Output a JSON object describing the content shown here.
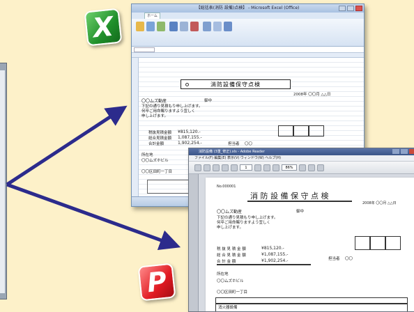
{
  "excel": {
    "window_title": "【総括表(消防 設備)点検】 - Microsoft Excel (Office)",
    "tab_home": "ホーム",
    "doc_title": "消防設備保守点検",
    "date_line": "2008年 〇〇月 △△日",
    "recipient": "〇〇ムズ動産",
    "honorific": "御中",
    "greeting_1": "下記の通り見積もり申し上げます。",
    "greeting_2": "何卒ご用命賜りますよう宜しく",
    "greeting_3": "申し上げます。",
    "amount_1_label": "税抜見積金額",
    "amount_1_value": "¥815,120.-",
    "amount_2_label": "総合見積金額",
    "amount_2_value": "1,087,155.-",
    "amount_3_label": "合計金額",
    "amount_3_value": "1,902,254.-",
    "person_label": "担当者",
    "person_value": "〇〇",
    "address_label": "所在地",
    "address_value": "〇〇ムズホビル",
    "building": "〇〇区田町一丁目"
  },
  "pdf": {
    "window_title": "消防設備 (3重_修正).xls - Adobe Reader",
    "menu": "ファイル(F)  編集(E)  表示(V)  ウィンドウ(W)  ヘルプ(H)",
    "page_field": "1",
    "zoom_field": "86%",
    "doc_no": "No.000001",
    "doc_title": "消 防 設 備 保 守 点 検",
    "date_line": "2008年 〇〇月 △△日",
    "recipient": "〇〇ムズ動産",
    "honorific": "御中",
    "greeting_1": "下記の通り見積もり申し上げます。",
    "greeting_2": "何卒ご用命賜りますよう宜しく",
    "greeting_3": "申し上げます。",
    "amount_1_label": "税 抜 見 積 金 額",
    "amount_1_value": "¥815,120.-",
    "amount_2_label": "総 合 見 積 金 額",
    "amount_2_value": "¥1,087,155.-",
    "amount_3_label": "合 計 金 額",
    "amount_3_value": "¥1,902,254.-",
    "person_label": "担当者",
    "person_value": "〇〇",
    "address_label": "所在地",
    "address_value": "〇〇ムズホビル",
    "building": "〇〇区田町一丁目",
    "table_header": "消火器設備"
  },
  "badges": {
    "excel_letter": "X",
    "pdf_letter": "P"
  },
  "colors": {
    "background": "#fdf1c9",
    "arrow": "#2c2b8c",
    "excel_green": "#1f8f2a",
    "pdf_red": "#e01a22"
  }
}
